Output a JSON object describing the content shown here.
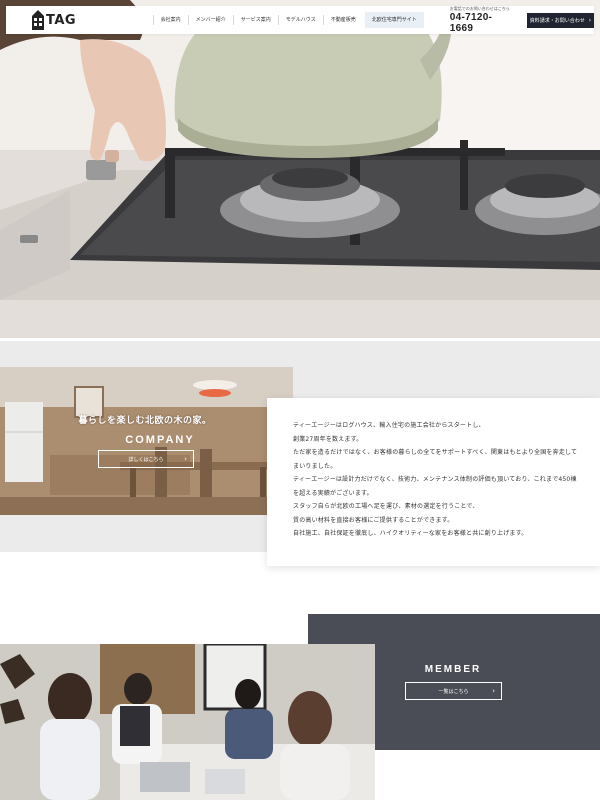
{
  "header": {
    "logo_text": "TAG",
    "nav": [
      {
        "label": "会社案内"
      },
      {
        "label": "メンバー紹介"
      },
      {
        "label": "サービス案内"
      },
      {
        "label": "モデルハウス"
      },
      {
        "label": "不動産販売"
      },
      {
        "label": "北欧住宅専門サイト"
      }
    ],
    "contact_label": "お電話でのお問い合わせはこちら",
    "phone": "04-7120-1669",
    "cta_label": "資料請求・お問い合わせ",
    "chevron": "›"
  },
  "hero": {
    "image": "kettle-on-gas-stove-photo"
  },
  "company": {
    "tagline": "暮らしを楽しむ北欧の木の家。",
    "title": "COMPANY",
    "button_label": "詳しくはこちら",
    "chevron": "›",
    "image": "nordic-wooden-kitchen-photo",
    "text_lines": [
      "ティーエージーはログハウス、輸入住宅の施工会社からスタートし、",
      "創業27周年を数えます。",
      "ただ家を造るだけではなく、お客様の暮らしの全てをサポートすべく、関東はもとより全国を奔走して",
      "まいりました。",
      "ティーエージーは設計力だけでなく、技術力、メンテナンス体制の評価も頂いており、これまで450棟",
      "を超える実績がございます。",
      "スタッフ自らが北欧の工場へ足を運び、素材の選定を行うことで、",
      "質の高い材料を直接お客様にご提供することができます。",
      "自社施工、自社保証を徹底し、ハイクオリティーな家をお客様と共に創り上げます。"
    ]
  },
  "member": {
    "title": "MEMBER",
    "button_label": "一覧はこちら",
    "chevron": "›",
    "image": "team-meeting-photo"
  },
  "colors": {
    "dark_navy": "#1f2430",
    "member_panel": "#4a4d55",
    "section_gray": "#ebebeb",
    "nav_highlight": "#e8eff6"
  }
}
